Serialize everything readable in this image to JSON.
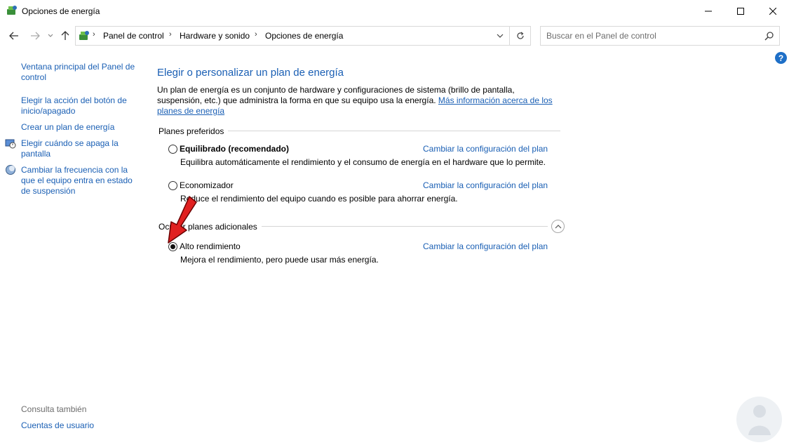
{
  "window": {
    "title": "Opciones de energía",
    "icon": "power-options-icon"
  },
  "address": {
    "crumbs": [
      "Panel de control",
      "Hardware y sonido",
      "Opciones de energía"
    ]
  },
  "search": {
    "placeholder": "Buscar en el Panel de control"
  },
  "sidebar": {
    "home_link_line1": "Ventana principal del Panel de",
    "home_link_line2": "control",
    "power_button_line1": "Elegir la acción del botón de",
    "power_button_line2": "inicio/apagado",
    "create_plan": "Crear un plan de energía",
    "screen_off_line1": "Elegir cuándo se apaga la",
    "screen_off_line2": "pantalla",
    "sleep_line1": "Cambiar la frecuencia con la",
    "sleep_line2": "que el equipo entra en estado",
    "sleep_line3": "de suspensión",
    "see_also": "Consulta también",
    "user_accounts": "Cuentas de usuario"
  },
  "main": {
    "title": "Elegir o personalizar un plan de energía",
    "description": "Un plan de energía es un conjunto de hardware y configuraciones de sistema (brillo de pantalla, suspensión, etc.) que administra la forma en que su equipo usa la energía. ",
    "more_info_link": "Más información acerca de los planes de energía",
    "preferred_group": "Planes preferidos",
    "additional_group": "Ocultar planes adicionales",
    "change_link": "Cambiar la configuración del plan",
    "plans": [
      {
        "name": "Equilibrado (recomendado)",
        "desc": "Equilibra automáticamente el rendimiento y el consumo de energía en el hardware que lo permite.",
        "selected": false
      },
      {
        "name": "Economizador",
        "desc": "Reduce el rendimiento del equipo cuando es posible para ahorrar energía.",
        "selected": false
      },
      {
        "name": "Alto rendimiento",
        "desc": "Mejora el rendimiento, pero puede usar más energía.",
        "selected": true
      }
    ]
  },
  "colors": {
    "link": "#1a5fb4",
    "arrow": "#e02020"
  }
}
